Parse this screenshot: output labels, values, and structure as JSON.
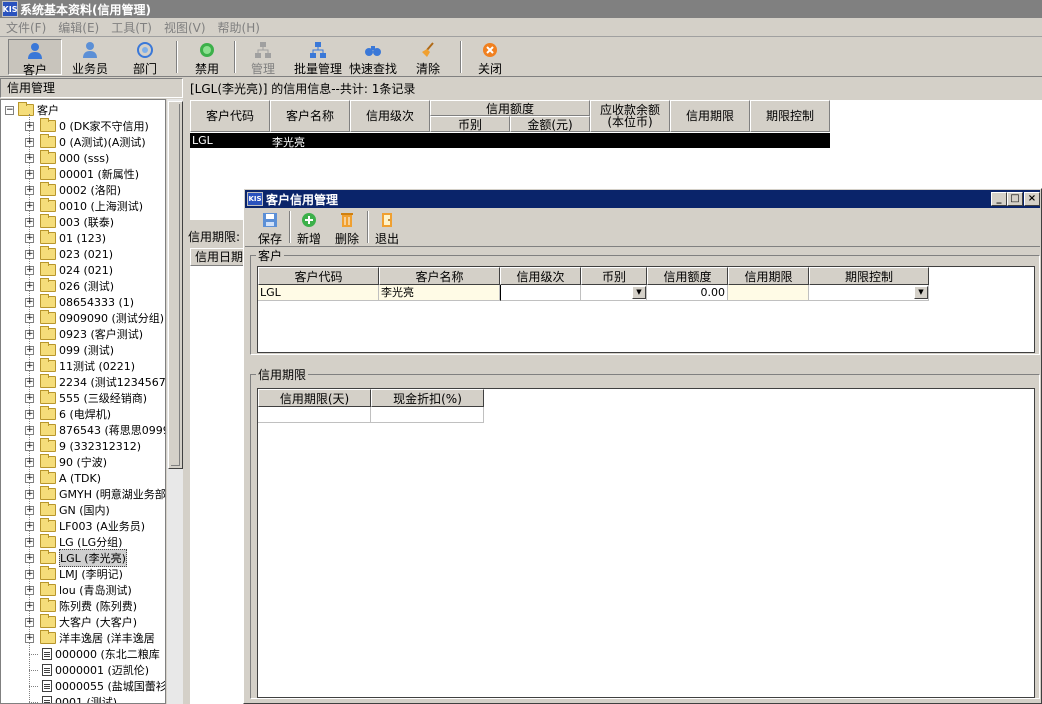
{
  "app": {
    "logo_text": "KIS",
    "title": "系统基本资料(信用管理)"
  },
  "menu": [
    "文件(F)",
    "编辑(E)",
    "工具(T)",
    "视图(V)",
    "帮助(H)"
  ],
  "toolbar": {
    "customer": "客户",
    "salesman": "业务员",
    "department": "部门",
    "disable": "禁用",
    "manage": "管理",
    "batch_manage": "批量管理",
    "quick_search": "快速查找",
    "clear": "清除",
    "close": "关闭"
  },
  "left_panel": {
    "header": "信用管理",
    "tree": {
      "root": "客户",
      "items": [
        {
          "label": "0 (DK家不守信用)",
          "type": "folder"
        },
        {
          "label": "0 (A测试)(A测试)",
          "type": "folder"
        },
        {
          "label": "000 (sss)",
          "type": "folder"
        },
        {
          "label": "00001 (新属性)",
          "type": "folder"
        },
        {
          "label": "0002 (洛阳)",
          "type": "folder"
        },
        {
          "label": "0010 (上海测试)",
          "type": "folder"
        },
        {
          "label": "003 (联泰)",
          "type": "folder"
        },
        {
          "label": "01 (123)",
          "type": "folder"
        },
        {
          "label": "023 (021)",
          "type": "folder"
        },
        {
          "label": "024 (021)",
          "type": "folder"
        },
        {
          "label": "026 (测试)",
          "type": "folder"
        },
        {
          "label": "08654333 (1)",
          "type": "folder"
        },
        {
          "label": "0909090 (测试分组)",
          "type": "folder"
        },
        {
          "label": "0923 (客户测试)",
          "type": "folder"
        },
        {
          "label": "099 (测试)",
          "type": "folder"
        },
        {
          "label": "11测试 (0221)",
          "type": "folder"
        },
        {
          "label": "2234 (测试12345678",
          "type": "folder"
        },
        {
          "label": "555 (三级经销商)",
          "type": "folder"
        },
        {
          "label": "6 (电焊机)",
          "type": "folder"
        },
        {
          "label": "876543 (蒋思思0999",
          "type": "folder"
        },
        {
          "label": "9 (332312312)",
          "type": "folder"
        },
        {
          "label": "90 (宁波)",
          "type": "folder"
        },
        {
          "label": "A (TDK)",
          "type": "folder"
        },
        {
          "label": "GMYH (明意湖业务部",
          "type": "folder"
        },
        {
          "label": "GN (国内)",
          "type": "folder"
        },
        {
          "label": "LF003 (A业务员)",
          "type": "folder"
        },
        {
          "label": "LG (LG分组)",
          "type": "folder"
        },
        {
          "label": "LGL (李光亮)",
          "type": "folder-open",
          "selected": true
        },
        {
          "label": "LMJ (李明记)",
          "type": "folder"
        },
        {
          "label": "lou (青岛测试)",
          "type": "folder"
        },
        {
          "label": "陈列费 (陈列费)",
          "type": "folder"
        },
        {
          "label": "大客户 (大客户)",
          "type": "folder"
        },
        {
          "label": "洋丰逸居 (洋丰逸居",
          "type": "folder"
        },
        {
          "label": "000000 (东北二粮库",
          "type": "doc"
        },
        {
          "label": "0000001 (迈凯伦)",
          "type": "doc"
        },
        {
          "label": "0000055 (盐城国蕾衫",
          "type": "doc"
        },
        {
          "label": "0001 (测试)",
          "type": "doc"
        }
      ]
    }
  },
  "main": {
    "info_label": "[LGL(李光亮)] 的信用信息--共计: 1条记录",
    "columns": {
      "code": "客户代码",
      "name": "客户名称",
      "level": "信用级次",
      "credit_amount": "信用额度",
      "currency": "币别",
      "amount": "金额(元)",
      "receivable_line1": "应收款余额",
      "receivable_line2": "(本位币)",
      "period": "信用期限",
      "control": "期限控制"
    },
    "row": {
      "code": "LGL",
      "name": "李光亮"
    },
    "lower_label": "信用期限:",
    "lower_header": "信用日期"
  },
  "dialog": {
    "logo_text": "KIS",
    "title": "客户信用管理",
    "toolbar": {
      "save": "保存",
      "add": "新增",
      "delete": "删除",
      "exit": "退出"
    },
    "customer_group": {
      "title": "客户",
      "columns": [
        "客户代码",
        "客户名称",
        "信用级次",
        "币别",
        "信用额度",
        "信用期限",
        "期限控制"
      ],
      "row": {
        "code": "LGL",
        "name": "李光亮",
        "level": "",
        "currency": "",
        "credit_amount": "0.00",
        "period": "",
        "control": ""
      }
    },
    "period_group": {
      "title": "信用期限",
      "columns": [
        "信用期限(天)",
        "现金折扣(%)"
      ]
    }
  }
}
